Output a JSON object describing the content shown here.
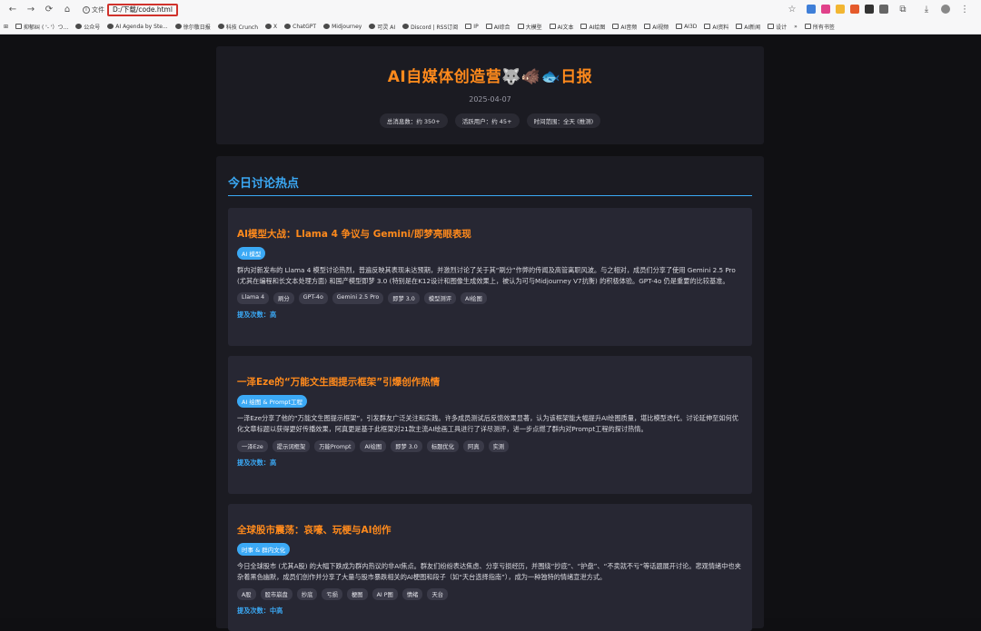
{
  "browser": {
    "address_prefix": "文件",
    "url": "D:/下载/code.html",
    "bookmarks": [
      "抑郁纠 ( '- '）つ...",
      "公众号",
      "AI Agenda by Ste...",
      "徐尔敬日报",
      "科技 Crunch",
      "X",
      "ChatGPT",
      "Midjourney",
      "可灵 AI",
      "Discord | RSS订阅",
      "IP",
      "AI综合",
      "大模型",
      "AI文本",
      "AI绘图",
      "AI音频",
      "AI视频",
      "AI3D",
      "AI资料",
      "AI新闻",
      "设计"
    ],
    "bookmarks_more": "»",
    "all_bookmarks": "所有书签"
  },
  "header": {
    "title": "AI自媒体创造营🐺🐗🐟日报",
    "date": "2025-04-07",
    "stats": [
      "总消息数：约 350+",
      "活跃用户：约 45+",
      "时间范围：全天 (推测)"
    ]
  },
  "section": {
    "title": "今日讨论热点"
  },
  "topics": [
    {
      "title": "AI模型大战：Llama 4 争议与 Gemini/即梦亮眼表现",
      "badge": "AI 模型",
      "body": "群内对新发布的 Llama 4 模型讨论热烈，普遍反映其表现未达预期，并激烈讨论了关于其“刷分”作弊的传闻及高管离职风波。与之相对，成员们分享了使用 Gemini 2.5 Pro (尤其在编程和长文本处理方面) 和国产模型即梦 3.0 (特别是在K12设计和图像生成效果上，被认为可与Midjourney V7抗衡) 的积极体验。GPT-4o 仍是重要的比较基准。",
      "tags": [
        "Llama 4",
        "刷分",
        "GPT-4o",
        "Gemini 2.5 Pro",
        "即梦 3.0",
        "模型测评",
        "AI绘图"
      ],
      "mention": "提及次数：高"
    },
    {
      "title": "一泽Eze的“万能文生图提示框架”引爆创作热情",
      "badge": "AI 绘图 & Prompt工程",
      "body": "一泽Eze分享了他的“万能文生图提示框架”，引发群友广泛关注和实践。许多成员测试后反馈效果显著，认为该框架能大幅提升AI绘图质量，堪比模型迭代。讨论延伸至如何优化文章标题以获得更好传播效果，阿真更是基于此框架对21款主流AI绘画工具进行了详尽测评，进一步点燃了群内对Prompt工程的探讨热情。",
      "tags": [
        "一泽Eze",
        "提示词框架",
        "万能Prompt",
        "AI绘图",
        "即梦 3.0",
        "标题优化",
        "阿真",
        "实测"
      ],
      "mention": "提及次数：高"
    },
    {
      "title": "全球股市震荡：哀嚎、玩梗与AI创作",
      "badge": "时事 & 群内文化",
      "body": "今日全球股市 (尤其A股) 的大幅下跌成为群内热议的非AI焦点。群友们纷纷表达焦虑、分享亏损经历，并围绕“抄底”、“护盘”、“不卖就不亏”等话题展开讨论。悲观情绪中也夹杂着黑色幽默，成员们创作并分享了大量与股市暴跌相关的AI梗图和段子（如“天台选择指南”），成为一种独特的情绪宣泄方式。",
      "tags": [
        "A股",
        "股市崩盘",
        "抄底",
        "亏损",
        "梗图",
        "AI P图",
        "情绪",
        "天台"
      ],
      "mention": "提及次数：中高"
    }
  ]
}
